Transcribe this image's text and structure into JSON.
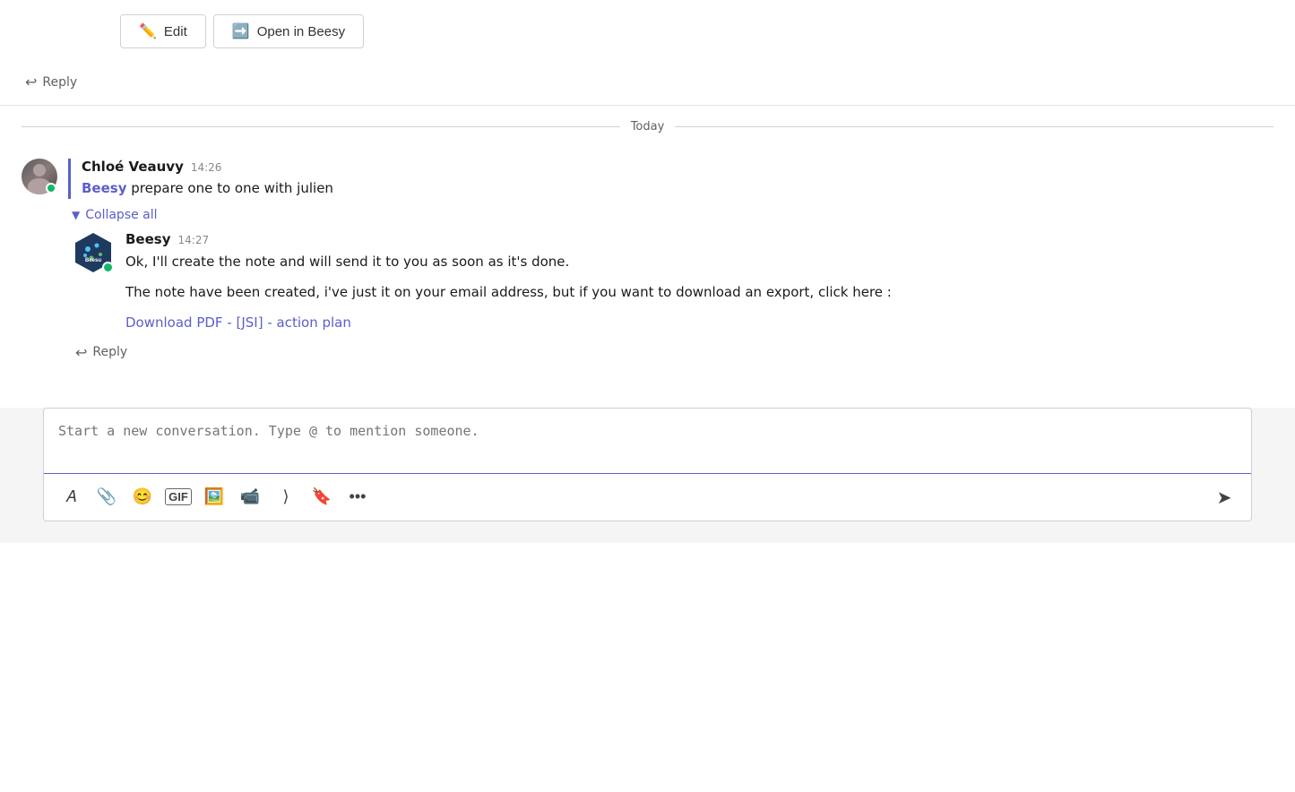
{
  "top_message": {
    "edit_button_label": "Edit",
    "open_button_label": "Open in Beesy",
    "reply_label": "Reply"
  },
  "date_divider": {
    "label": "Today"
  },
  "main_message": {
    "author": "Chloé Veauvy",
    "time": "14:26",
    "mention": "Beesy",
    "text": " prepare one to one with julien",
    "collapse_label": "Collapse all"
  },
  "bot_message": {
    "author": "Beesy",
    "time": "14:27",
    "line1": "Ok, I'll create the note and will send it to you as soon as it's done.",
    "line2": "The note have been created, i've just it on your email address, but if you want to download an export, click here :",
    "download_link": "Download PDF - [JSI] - action plan",
    "reply_label": "Reply"
  },
  "compose": {
    "placeholder": "Start a new conversation. Type @ to mention someone.",
    "toolbar": {
      "format_icon": "format",
      "attach_icon": "attach",
      "emoji_icon": "emoji",
      "gif_icon": "gif",
      "image_icon": "image",
      "video_icon": "video",
      "send_icon": "send",
      "loop_icon": "loop",
      "bookmark_icon": "bookmark",
      "more_icon": "more"
    }
  }
}
